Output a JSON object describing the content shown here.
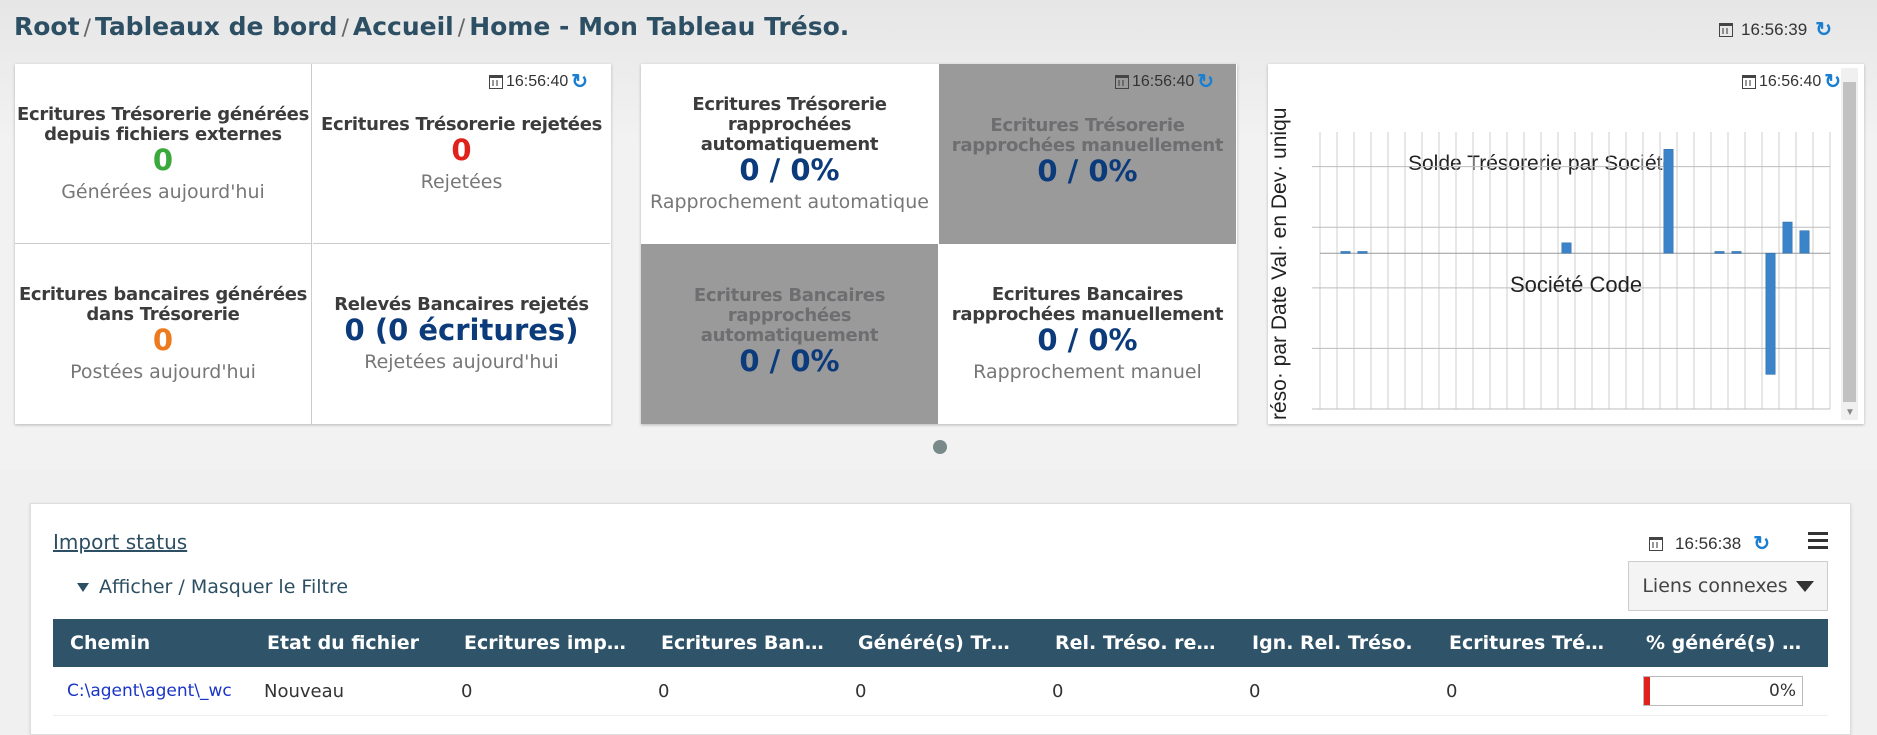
{
  "breadcrumb": [
    "Root",
    "Tableaux de bord",
    "Accueil",
    "Home - Mon Tableau Tréso."
  ],
  "header": {
    "time": "16:56:39"
  },
  "widget1": {
    "time": "16:56:40",
    "cells": [
      {
        "title": "Ecritures Trésorerie générées depuis fichiers externes",
        "value": "0",
        "sub": "Générées aujourd'hui",
        "color": "green"
      },
      {
        "title": "Ecritures Trésorerie rejetées",
        "value": "0",
        "sub": "Rejetées",
        "color": "red"
      },
      {
        "title": "Ecritures bancaires générées dans Trésorerie",
        "value": "0",
        "sub": "Postées aujourd'hui",
        "color": "orange"
      },
      {
        "title": "Relevés Bancaires rejetés",
        "value": "0 (0 écritures)",
        "sub": "Rejetées aujourd'hui",
        "color": "blue"
      }
    ]
  },
  "widget2": {
    "time": "16:56:40",
    "cells": [
      {
        "title": "Ecritures Trésorerie rapprochées automatiquement",
        "value": "0 / 0%",
        "sub": "Rapprochement automatique"
      },
      {
        "title": "Ecritures Trésorerie rapprochées manuellement",
        "value": "0 / 0%",
        "sub": ""
      },
      {
        "title": "Ecritures Bancaires rapprochées automatiquement",
        "value": "0 / 0%",
        "sub": ""
      },
      {
        "title": "Ecritures Bancaires rapprochées manuellement",
        "value": "0 / 0%",
        "sub": "Rapprochement manuel"
      }
    ]
  },
  "widget3": {
    "time": "16:56:40"
  },
  "chart_data": {
    "type": "bar",
    "title": "Solde Trésorerie par Société",
    "xlabel": "Société Code",
    "ylabel": "réso· par Date Val· en Dev· uniqu",
    "categories": [
      "",
      "",
      "",
      "",
      "",
      "",
      "",
      "",
      "",
      "",
      "",
      "",
      "",
      "",
      "",
      "",
      "",
      "",
      "",
      "",
      "",
      "",
      "",
      "",
      "",
      "",
      "",
      "",
      "",
      ""
    ],
    "values": [
      0,
      0.1,
      0.1,
      0,
      0,
      0,
      0,
      0,
      0,
      0,
      0,
      0,
      0,
      0,
      0.6,
      0,
      0,
      0,
      0,
      0,
      6,
      0,
      0,
      0.1,
      0.1,
      0,
      -7,
      1.8,
      1.3,
      0
    ],
    "ylim": [
      -9,
      7
    ],
    "grid": true
  },
  "panel": {
    "title": "Import status",
    "time": "16:56:38",
    "filter_label": "Afficher / Masquer le Filtre",
    "links_label": "Liens connexes",
    "columns": [
      "Chemin",
      "Etat du fichier",
      "Ecritures impo...",
      "Ecritures Banc....",
      "Généré(s) Tréso.",
      "Rel. Tréso. reje...",
      "Ign. Rel. Tréso.",
      "Ecritures Tréso...",
      "% généré(s) da..."
    ],
    "rows": [
      {
        "chemin": "C:\\agent\\agent\\_wc",
        "etat": "Nouveau",
        "c2": "0",
        "c3": "0",
        "c4": "0",
        "c5": "0",
        "c6": "0",
        "c7": "0",
        "pct": "0%",
        "pct_value": 0
      }
    ]
  }
}
